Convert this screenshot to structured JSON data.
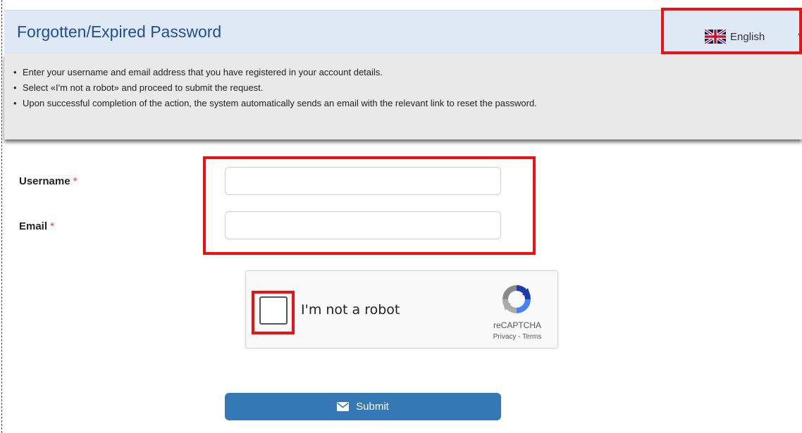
{
  "header": {
    "title": "Forgotten/Expired Password",
    "language": "English",
    "language_icon": "uk-flag-icon"
  },
  "instructions": {
    "items": [
      "Enter your username and email address that you have registered in your account details.",
      "Select «I'm not a robot» and proceed to submit the request.",
      "Upon successful completion of the action, the system automatically sends an email with the relevant link to reset the password."
    ]
  },
  "form": {
    "username_label": "Username",
    "email_label": "Email",
    "required_mark": "*",
    "username_value": "",
    "email_value": ""
  },
  "recaptcha": {
    "label": "I'm not a robot",
    "brand": "reCAPTCHA",
    "privacy": "Privacy",
    "separator": " - ",
    "terms": "Terms",
    "icon": "recaptcha-logo-icon"
  },
  "submit": {
    "label": "Submit",
    "icon": "envelope-icon"
  },
  "colors": {
    "header_bg": "#dfe8f5",
    "title": "#1f4e96",
    "button": "#3478b5",
    "highlight": "#ee1111"
  }
}
